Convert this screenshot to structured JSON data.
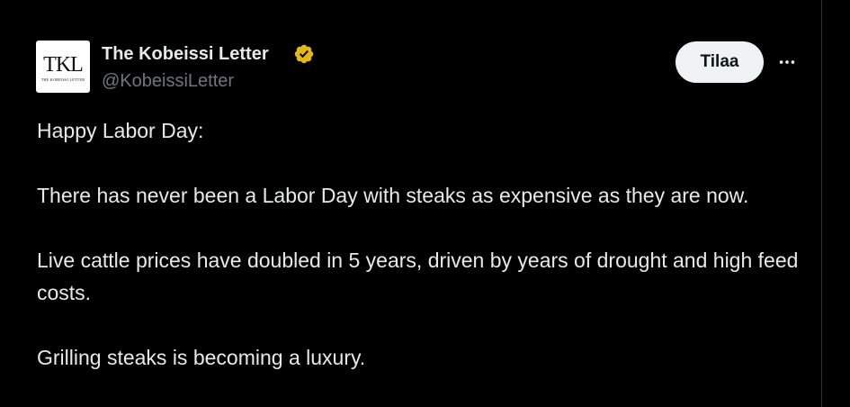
{
  "author": {
    "name": "The Kobeissi Letter",
    "handle": "@KobeissiLetter",
    "avatar_logo": "TKL",
    "avatar_subtitle": "THE KOBEISSI LETTER",
    "verified_icon": "verified-badge-gold"
  },
  "actions": {
    "subscribe_label": "Tilaa",
    "more_icon": "more-horizontal-icon"
  },
  "tweet": {
    "paragraphs": [
      "Happy Labor Day:",
      "There has never been a Labor Day with steaks as expensive as they are now.",
      "Live cattle prices have doubled in 5 years, driven by years of drought and high feed costs.",
      "Grilling steaks is becoming a luxury."
    ]
  },
  "colors": {
    "background": "#000000",
    "text_primary": "#e7e9ea",
    "text_secondary": "#71767b",
    "verified_gold": "#e2b719",
    "button_bg": "#eff3f4"
  }
}
